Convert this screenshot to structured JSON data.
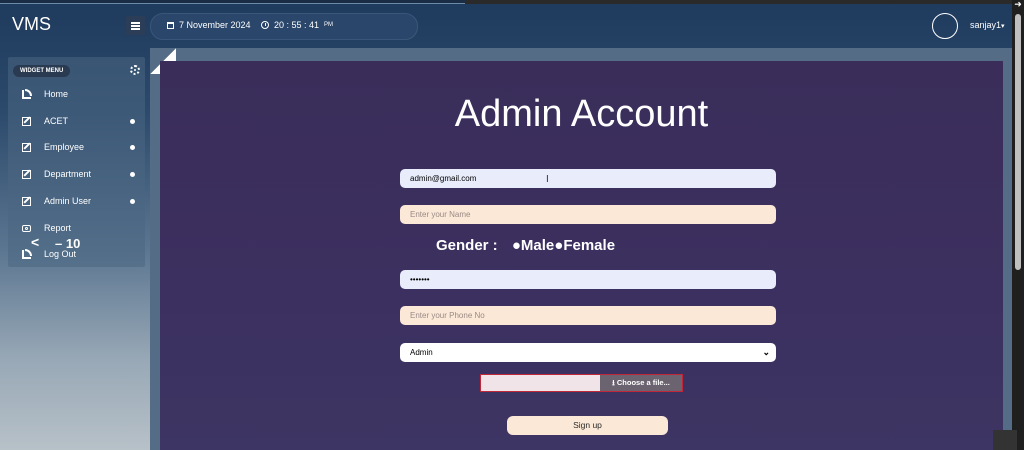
{
  "header": {
    "brand": "VMS",
    "date": "7 November 2024",
    "time": "20 : 55 : 41",
    "time_suffix": "PM",
    "user": "sanjay1",
    "user_caret": "▾"
  },
  "sidebar": {
    "widget_label": "WIDGET MENU",
    "items": [
      {
        "label": "Home",
        "icon": "rss-icon"
      },
      {
        "label": "ACET",
        "icon": "edit-icon"
      },
      {
        "label": "Employee",
        "icon": "edit-icon"
      },
      {
        "label": "Department",
        "icon": "edit-icon"
      },
      {
        "label": "Admin User",
        "icon": "edit-icon"
      },
      {
        "label": "Report",
        "icon": "camera-icon"
      },
      {
        "label": "Log Out",
        "icon": "rss-icon"
      }
    ],
    "overlay_back": "<",
    "overlay_text": "– 10"
  },
  "form": {
    "title": "Admin Account",
    "email_value": "admin@gmail.com",
    "name_placeholder": "Enter your Name",
    "gender_label": "Gender :",
    "gender_male": "●Male",
    "gender_female": "●Female",
    "password_value": "•••••••",
    "phone_placeholder": "Enter your Phone No",
    "role_selected": "Admin",
    "role_caret": "⌄",
    "file_button": "Choose a file...",
    "signup_label": "Sign up"
  },
  "colors": {
    "content_bg": "#3a2d5a",
    "input_blue": "#e8ecfb",
    "input_peach": "#fbe8d6",
    "file_border": "#c0283a"
  }
}
